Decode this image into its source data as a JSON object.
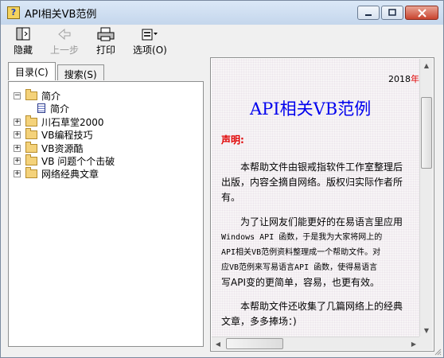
{
  "window": {
    "title": "API相关VB范例"
  },
  "toolbar": {
    "hide_label": "隐藏",
    "back_label": "上一步",
    "print_label": "打印",
    "options_label": "选项(O)"
  },
  "tabs": {
    "contents": "目录(C)",
    "search": "搜索(S)"
  },
  "tree": [
    {
      "label": "简介",
      "expander": "−"
    },
    {
      "label": "简介"
    },
    {
      "label": "川石草堂2000",
      "expander": "+"
    },
    {
      "label": "VB编程技巧",
      "expander": "+"
    },
    {
      "label": "VB资源酷",
      "expander": "+"
    },
    {
      "label": "VB 问题个个击破",
      "expander": "+"
    },
    {
      "label": "网络经典文章",
      "expander": "+"
    }
  ],
  "content": {
    "date_prefix": "2018",
    "date_suffix": "年'",
    "title": "API相关VB范例",
    "declaration": "声明:",
    "para1_line1": "本帮助文件由银戒指软件工作室整理后",
    "para1_line2": "出版，内容全摘自网络。版权归实际作者所",
    "para1_line3": "有。",
    "para2_line1": "为了让网友们能更好的在易语言里应用",
    "para2_line2": "Windows API 函数，于是我为大家将网上的",
    "para2_line3": "API相关VB范例资料整理成一个帮助文件。对",
    "para2_line4": "应VB范例来写易语言API 函数，使得易语言",
    "para2_line5": "写API变的更简单，容易，也更有效。",
    "para3_line1": "本帮助文件还收集了几篇网络上的经典",
    "para3_line2": "文章，多多捧场：)"
  },
  "colors": {
    "title_blue": "#0000ee",
    "red": "#e00000"
  }
}
